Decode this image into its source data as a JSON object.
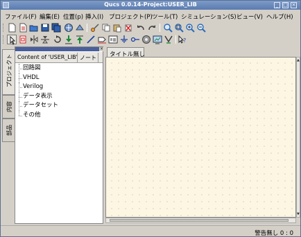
{
  "window": {
    "title": "Qucs 0.0.14-Project:USER_LIB"
  },
  "menubar": [
    "ファイル(F)",
    "編集(E)",
    "位置(p)",
    "挿入(I)",
    "プロジェクト(P)",
    "ツール(T)",
    "シミュレーション(S)",
    "ビュー(V)",
    "ヘルプ(H)"
  ],
  "toolbar_icons": {
    "row1": [
      "new-file-icon",
      "new-text-icon",
      "open-icon",
      "save-icon",
      "save-all-icon",
      "print-icon",
      "export-icon",
      "cut-icon",
      "copy-icon",
      "paste-icon",
      "delete-icon",
      "undo-icon",
      "redo-icon",
      "zoom-fit-icon",
      "zoom-selection-icon",
      "zoom-in-icon",
      "zoom-out-icon"
    ],
    "row2": [
      "select-icon",
      "deactivate-icon",
      "mirror-x-icon",
      "mirror-y-icon",
      "rotate-icon",
      "go-into-subcircuit-icon",
      "pop-out-icon",
      "wire-icon",
      "wire-label-icon",
      "insert-equation-icon",
      "ground-icon",
      "port-icon",
      "simulate-icon",
      "view-data-icon",
      "marker-icon",
      "whats-this-icon"
    ]
  },
  "side_tabs": [
    "プロジェクト",
    "内容",
    "部品"
  ],
  "dock": {
    "columns": [
      "Content of 'USER_LIB'",
      "ノート"
    ],
    "items": [
      "回路図",
      "VHDL",
      "Verilog",
      "データ表示",
      "データセット",
      "その他"
    ]
  },
  "document_tab": "タイトル無し",
  "status": "警告無し 0 : 0",
  "colors": {
    "title_bar": "#5a7bb0",
    "canvas": "#fcf6e2",
    "dock_header": "#4a5f9a"
  }
}
